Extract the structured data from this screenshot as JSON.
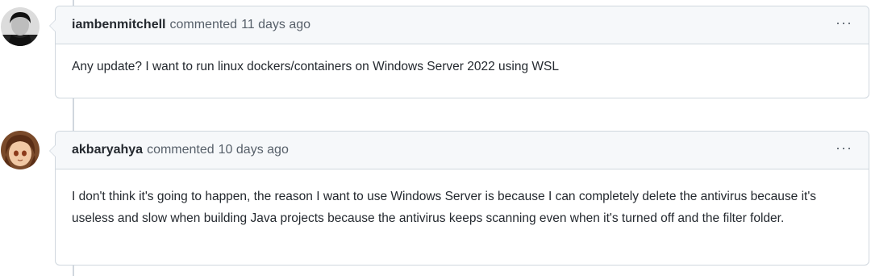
{
  "comments": [
    {
      "author": "iambenmitchell",
      "action": "commented",
      "time": "11 days ago",
      "menu_icon": "···",
      "body": "Any update? I want to run linux dockers/containers on Windows Server 2022 using WSL"
    },
    {
      "author": "akbaryahya",
      "action": "commented",
      "time": "10 days ago",
      "menu_icon": "···",
      "body": "I don't think it's going to happen, the reason I want to use Windows Server is because I can completely delete the antivirus because it's useless and slow when building Java projects because the antivirus keeps scanning even when it's turned off and the filter folder."
    }
  ]
}
